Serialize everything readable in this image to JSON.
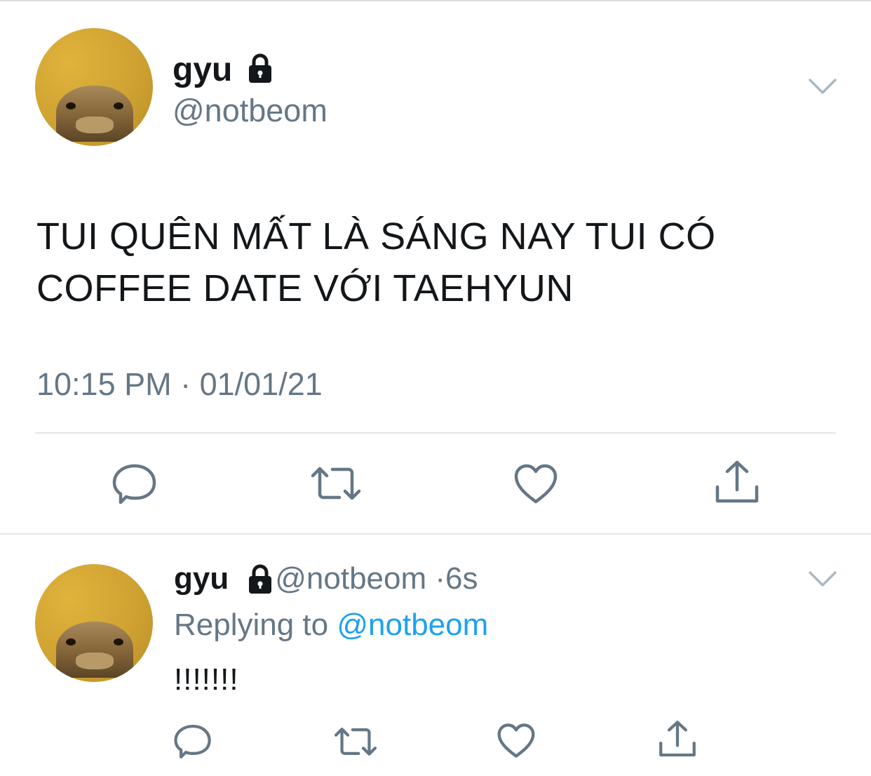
{
  "main_tweet": {
    "display_name": "gyu",
    "handle": "@notbeom",
    "text_line1": "TUI QUÊN MẤT LÀ SÁNG NAY TUI CÓ",
    "text_line2": "COFFEE DATE VỚI TAEHYUN",
    "timestamp": "10:15 PM · 01/01/21",
    "icons": [
      "avatar",
      "lock-icon",
      "chevron-down-icon",
      "reply-icon",
      "retweet-icon",
      "like-icon",
      "share-icon"
    ]
  },
  "reply_tweet": {
    "display_name": "gyu",
    "handle": "@notbeom",
    "separator": "·",
    "age": "6s",
    "replying_prefix": "Replying to",
    "replying_mention": "@notbeom",
    "text": "!!!!!!!",
    "icons": [
      "avatar",
      "lock-icon",
      "chevron-down-icon",
      "reply-icon",
      "retweet-icon",
      "like-icon",
      "share-icon"
    ]
  },
  "colors": {
    "text": "#14171a",
    "secondary": "#657786",
    "link": "#1da1f2",
    "divider": "#e1e8ed",
    "avatar": "#d2a434"
  }
}
